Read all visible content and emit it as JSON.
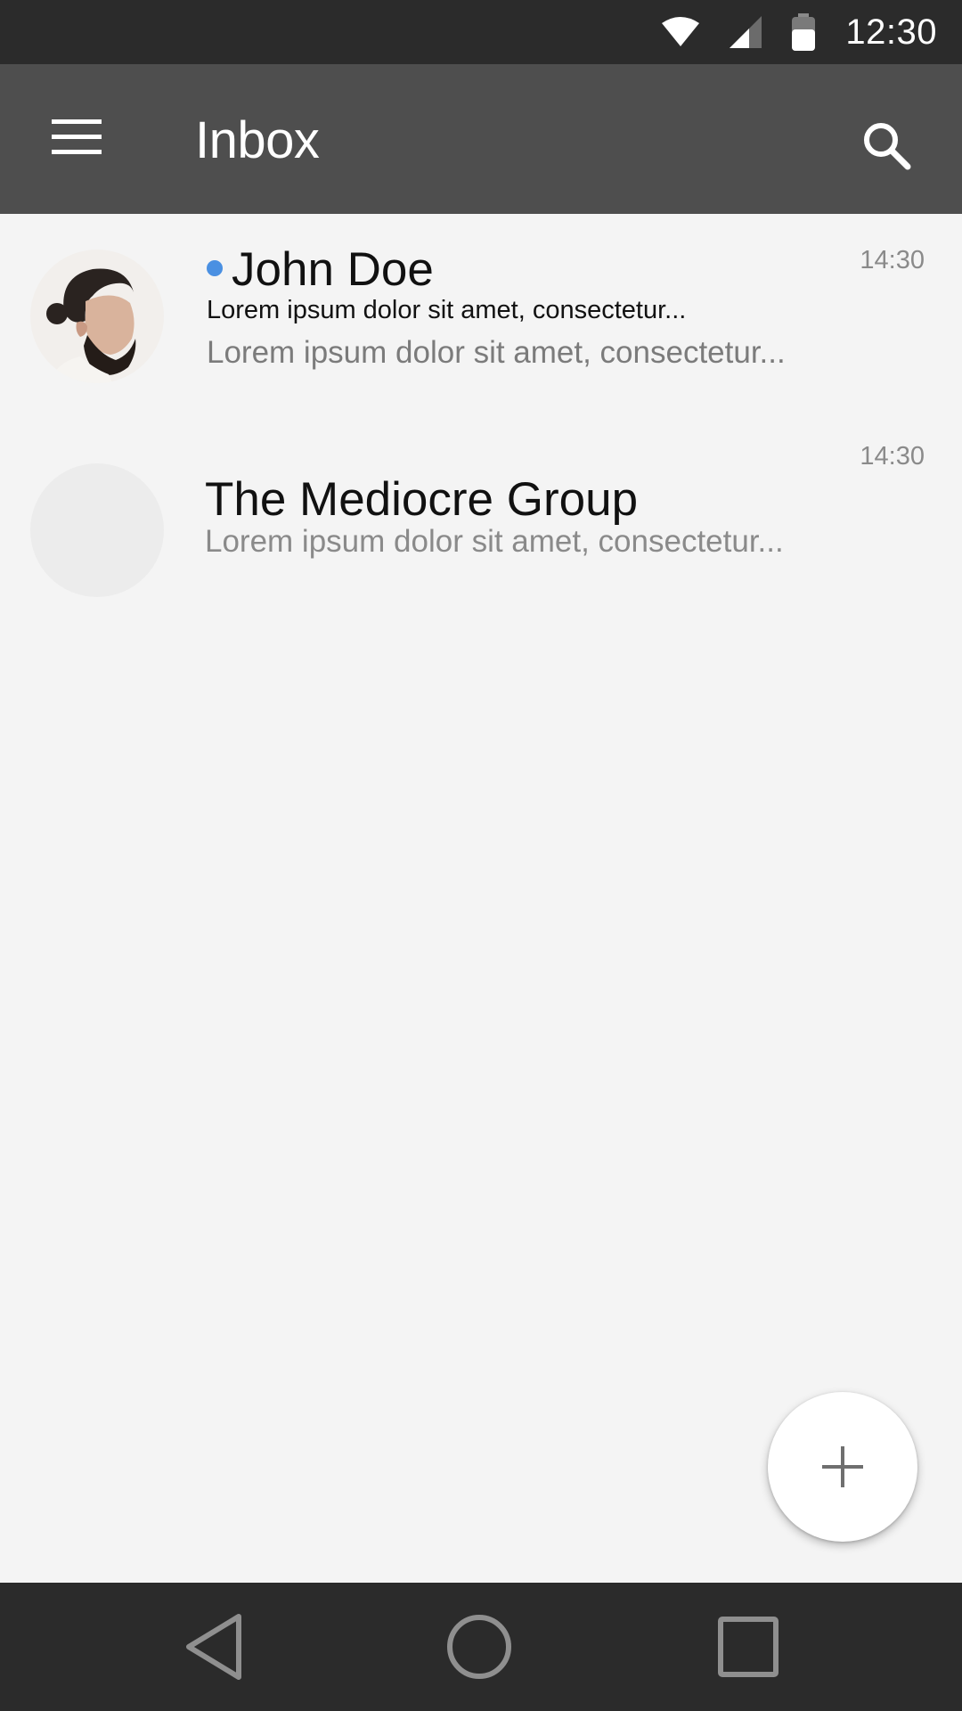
{
  "status_bar": {
    "time": "12:30"
  },
  "app_bar": {
    "title": "Inbox",
    "menu_icon": "menu-icon",
    "search_icon": "search-icon"
  },
  "messages": [
    {
      "sender": "John Doe",
      "subject": "Lorem ipsum dolor sit amet, consectetur...",
      "preview": "Lorem ipsum dolor sit amet, consectetur...",
      "time": "14:30",
      "unread": true
    },
    {
      "sender": "The Mediocre Group",
      "preview": "Lorem ipsum dolor sit amet, consectetur...",
      "time": "14:30",
      "unread": false
    }
  ],
  "fab": {
    "icon": "plus-icon"
  },
  "colors": {
    "app_bar": "#4e4e4e",
    "status_bar": "#2b2b2b",
    "unread_dot": "#4a90e2",
    "background": "#f4f4f4"
  },
  "nav_bar": {
    "icons": [
      "back-icon",
      "home-icon",
      "recents-icon"
    ]
  }
}
